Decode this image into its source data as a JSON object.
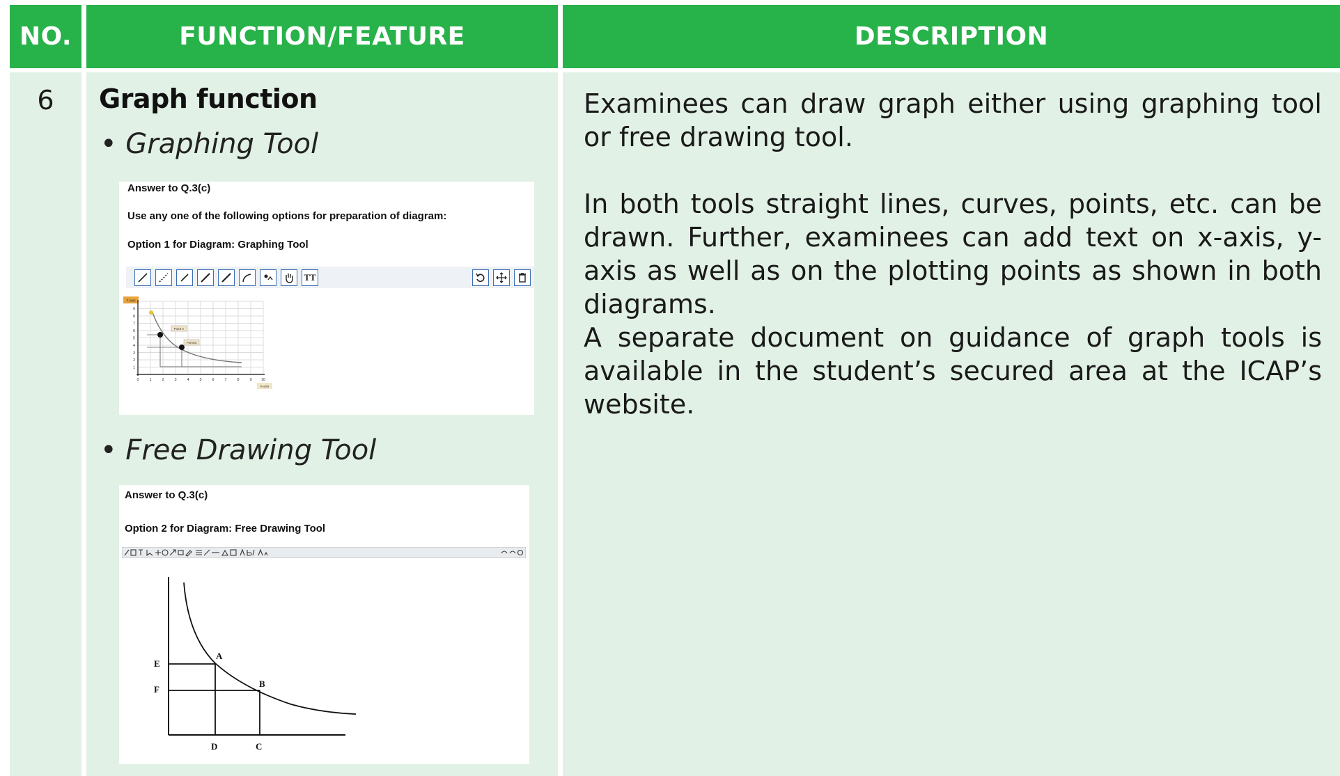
{
  "header": {
    "no": "NO.",
    "function": "FUNCTION/FEATURE",
    "description": "DESCRIPTION"
  },
  "row": {
    "number": "6",
    "title": "Graph function",
    "bullet_1": "• Graphing Tool",
    "bullet_2": "• Free Drawing Tool",
    "description_p1": "Examinees can draw graph either using graphing tool or free drawing tool.",
    "description_p2": "In both tools straight lines, curves, points, etc. can be drawn. Further, examinees can add text on x-axis, y-axis as well as on the plotting points as shown in both diagrams.",
    "description_p3": "A separate document on guidance of graph tools is available in the student’s secured area at the ICAP’s website."
  },
  "graphing_shot": {
    "answer": "Answer to Q.3(c)",
    "instruction": "Use any one of the following options for preparation of diagram:",
    "option": "Option 1 for Diagram: Graphing Tool",
    "text_tool": "TT",
    "y_label": "Y-axis",
    "x_label": "X-axis",
    "point_a": "Point A",
    "point_b": "Point B",
    "x_ticks": [
      "0",
      "1",
      "2",
      "3",
      "4",
      "5",
      "6",
      "7",
      "8",
      "9",
      "10"
    ],
    "y_ticks": [
      "1",
      "2",
      "3",
      "4",
      "5",
      "6",
      "7",
      "8",
      "9"
    ]
  },
  "freedraw_shot": {
    "answer": "Answer to Q.3(c)",
    "option": "Option 2 for Diagram: Free Drawing Tool",
    "label_e": "E",
    "label_f": "F",
    "label_a": "A",
    "label_b": "B",
    "label_d": "D",
    "label_c": "C"
  },
  "colors": {
    "header_green": "#27b24a",
    "cell_bg": "#e2f1e5",
    "toolbar_blue": "#3b6fb3"
  },
  "icons": [
    "line-tool-icon",
    "dotted-line-tool-icon",
    "segment-tool-icon",
    "arrow-tool-icon",
    "ray-tool-icon",
    "curve-tool-icon",
    "point-tool-icon",
    "hand-tool-icon",
    "text-tool-icon",
    "undo-icon",
    "move-icon",
    "delete-icon"
  ]
}
